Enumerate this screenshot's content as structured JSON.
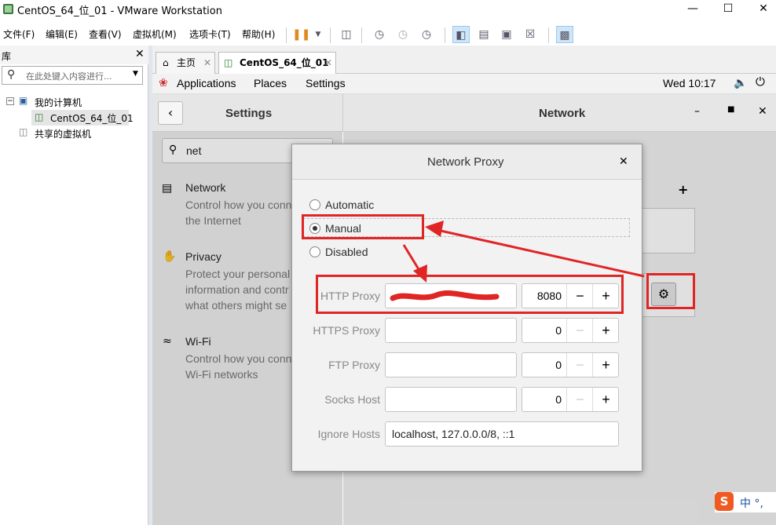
{
  "window": {
    "title": "CentOS_64_位_01 - VMware Workstation"
  },
  "menubar": {
    "items": [
      "文件(F)",
      "编辑(E)",
      "查看(V)",
      "虚拟机(M)",
      "选项卡(T)",
      "帮助(H)"
    ]
  },
  "library": {
    "title": "库",
    "search_placeholder": "在此处键入内容进行...",
    "tree": {
      "root": "我的计算机",
      "vm": "CentOS_64_位_01",
      "shared": "共享的虚拟机"
    }
  },
  "tabs": [
    {
      "label": "主页"
    },
    {
      "label": "CentOS_64_位_01"
    }
  ],
  "gnome": {
    "applications": "Applications",
    "places": "Places",
    "settings": "Settings",
    "clock": "Wed 10:17"
  },
  "settings": {
    "sidebar_title": "Settings",
    "panel_title": "Network",
    "search_value": "net",
    "results": [
      {
        "title": "Network",
        "desc1": "Control how you conn",
        "desc2": "the Internet",
        "desc3": ""
      },
      {
        "title": "Privacy",
        "desc1": "Protect your personal",
        "desc2": "information and contr",
        "desc3": "what others might se"
      },
      {
        "title": "Wi-Fi",
        "desc1": "Control how you conn",
        "desc2": "Wi-Fi networks",
        "desc3": ""
      }
    ]
  },
  "dialog": {
    "title": "Network Proxy",
    "modes": [
      "Automatic",
      "Manual",
      "Disabled"
    ],
    "selected_mode": "Manual",
    "proxies": [
      {
        "label": "HTTP Proxy",
        "host": "",
        "port": "8080"
      },
      {
        "label": "HTTPS Proxy",
        "host": "",
        "port": "0"
      },
      {
        "label": "FTP Proxy",
        "host": "",
        "port": "0"
      },
      {
        "label": "Socks Host",
        "host": "",
        "port": "0"
      }
    ],
    "ignore_label": "Ignore Hosts",
    "ignore_value": "localhost, 127.0.0.0/8, ::1"
  },
  "ime": {
    "label": "中 °,"
  },
  "colors": {
    "annotation_red": "#e02525",
    "selected_tab_bg": "#ffffff"
  }
}
